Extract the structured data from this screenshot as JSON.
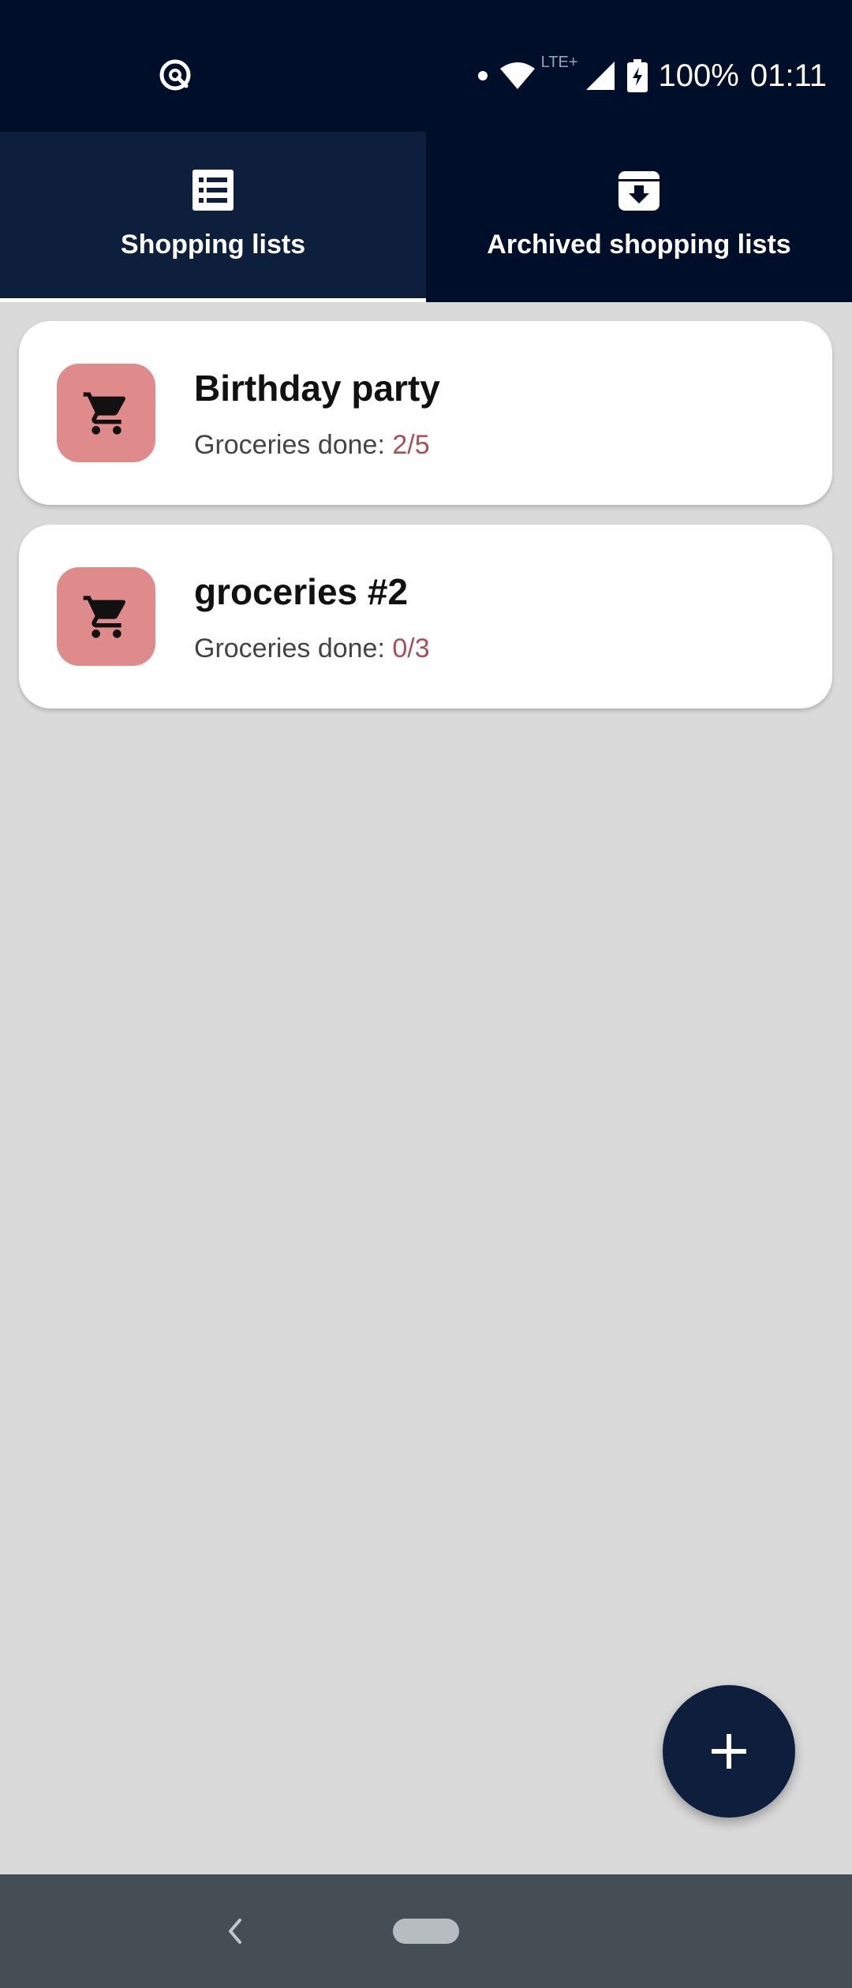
{
  "status_bar": {
    "network_type": "LTE+",
    "battery": "100%",
    "time": "01:11"
  },
  "tabs": [
    {
      "label": "Shopping lists",
      "icon": "list-icon",
      "active": true
    },
    {
      "label": "Archived shopping lists",
      "icon": "archive-icon",
      "active": false
    }
  ],
  "lists": [
    {
      "title": "Birthday party",
      "progress_label": "Groceries done:",
      "progress": "2/5",
      "icon": "cart-icon"
    },
    {
      "title": "groceries #2",
      "progress_label": "Groceries done:",
      "progress": "0/3",
      "icon": "cart-icon"
    }
  ],
  "fab": {
    "icon": "plus-icon"
  },
  "colors": {
    "header_bg": "#000f29",
    "active_tab_bg": "#0d1f3d",
    "card_icon_bg": "#e08b8b",
    "progress_text": "#a94f55",
    "background": "#dadada",
    "nav_bar": "#454d55"
  }
}
